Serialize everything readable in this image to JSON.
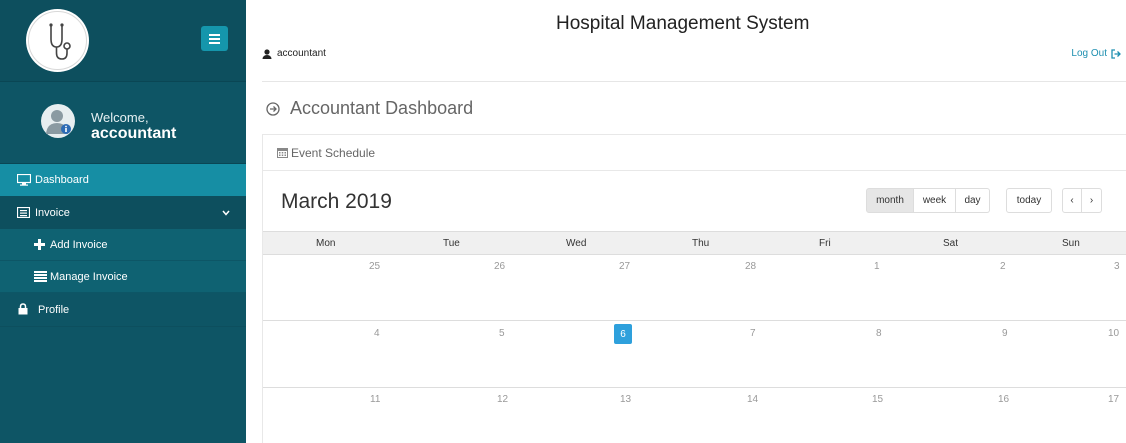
{
  "sidebar": {
    "welcome_label": "Welcome,",
    "username": "accountant",
    "items": [
      {
        "label": "Dashboard",
        "icon": "monitor-icon"
      },
      {
        "label": "Invoice",
        "icon": "invoice-icon"
      },
      {
        "label": "Add Invoice",
        "icon": "plus-icon"
      },
      {
        "label": "Manage Invoice",
        "icon": "list-icon"
      },
      {
        "label": "Profile",
        "icon": "lock-icon"
      }
    ]
  },
  "header": {
    "title": "Hospital Management System",
    "user": "accountant",
    "logout": "Log Out"
  },
  "page": {
    "title": "Accountant Dashboard"
  },
  "panel": {
    "title": "Event Schedule"
  },
  "calendar": {
    "month_title": "March 2019",
    "views": [
      "month",
      "week",
      "day"
    ],
    "active_view": "month",
    "today_label": "today",
    "prev": "‹",
    "next": "›",
    "weekdays": [
      "Mon",
      "Tue",
      "Wed",
      "Thu",
      "Fri",
      "Sat",
      "Sun"
    ],
    "weeks": [
      [
        "25",
        "26",
        "27",
        "28",
        "1",
        "2",
        "3"
      ],
      [
        "4",
        "5",
        "6",
        "7",
        "8",
        "9",
        "10"
      ],
      [
        "11",
        "12",
        "13",
        "14",
        "15",
        "16",
        "17"
      ]
    ],
    "today": "6"
  },
  "colors": {
    "sidebar": "#0e5565",
    "active_item": "#168ea4",
    "today_highlight": "#2ea0dc",
    "link": "#1e8fb0"
  }
}
